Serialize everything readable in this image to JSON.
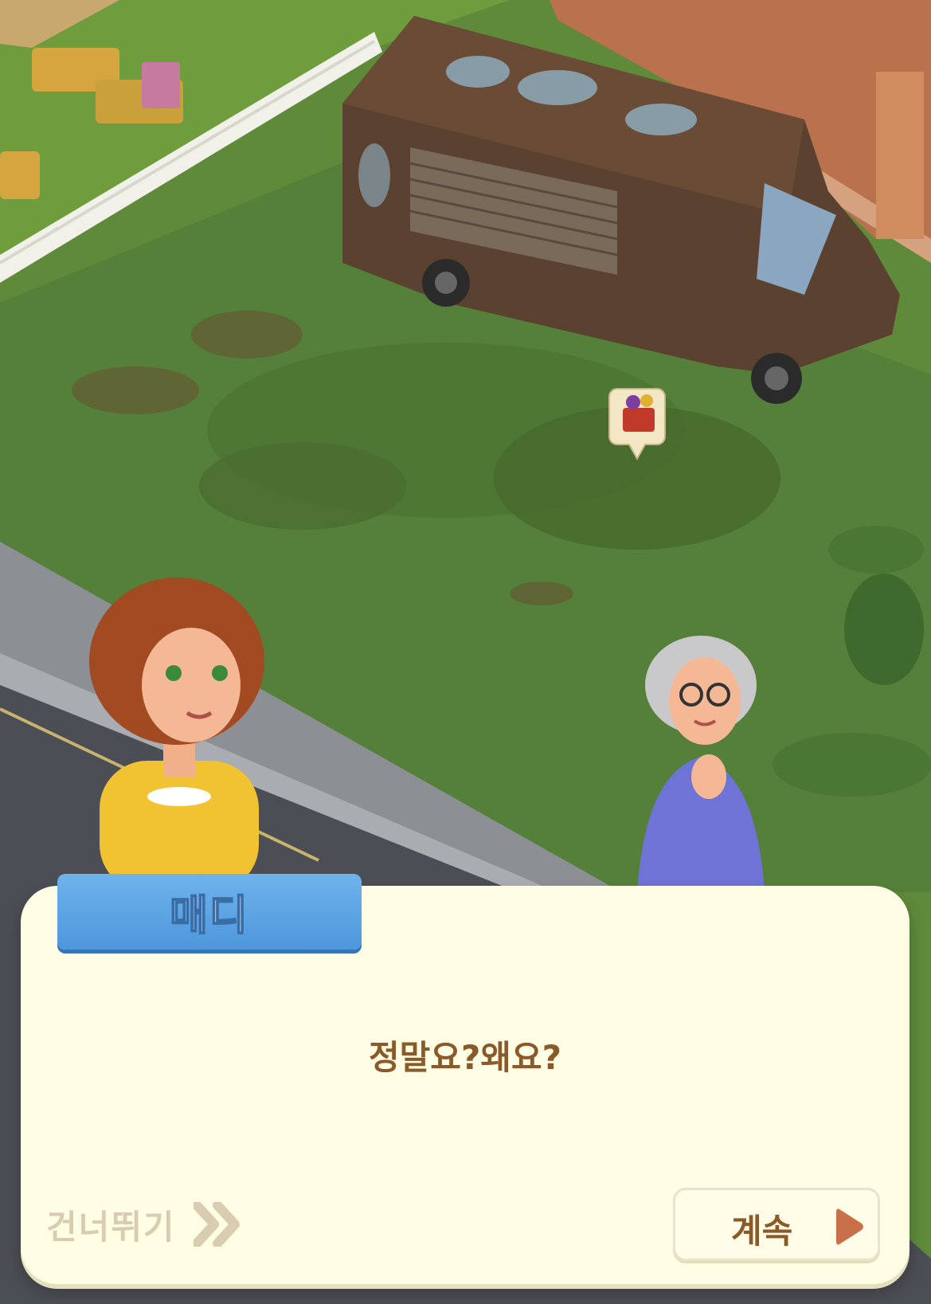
{
  "dialog": {
    "speaker": "매디",
    "text": "정말요?왜요?",
    "skip_label": "건너뛰기",
    "continue_label": "계속"
  },
  "colors": {
    "dialog_bg": "#fffde3",
    "name_tag": "#5aa3e6",
    "text_brown": "#8a5a2a",
    "skip_gray": "#d8cdb1",
    "grass": "#5f8a3a"
  },
  "icons": {
    "skip": "double-chevron-right-icon",
    "continue": "play-triangle-icon",
    "quest": "picnic-basket-icon"
  }
}
